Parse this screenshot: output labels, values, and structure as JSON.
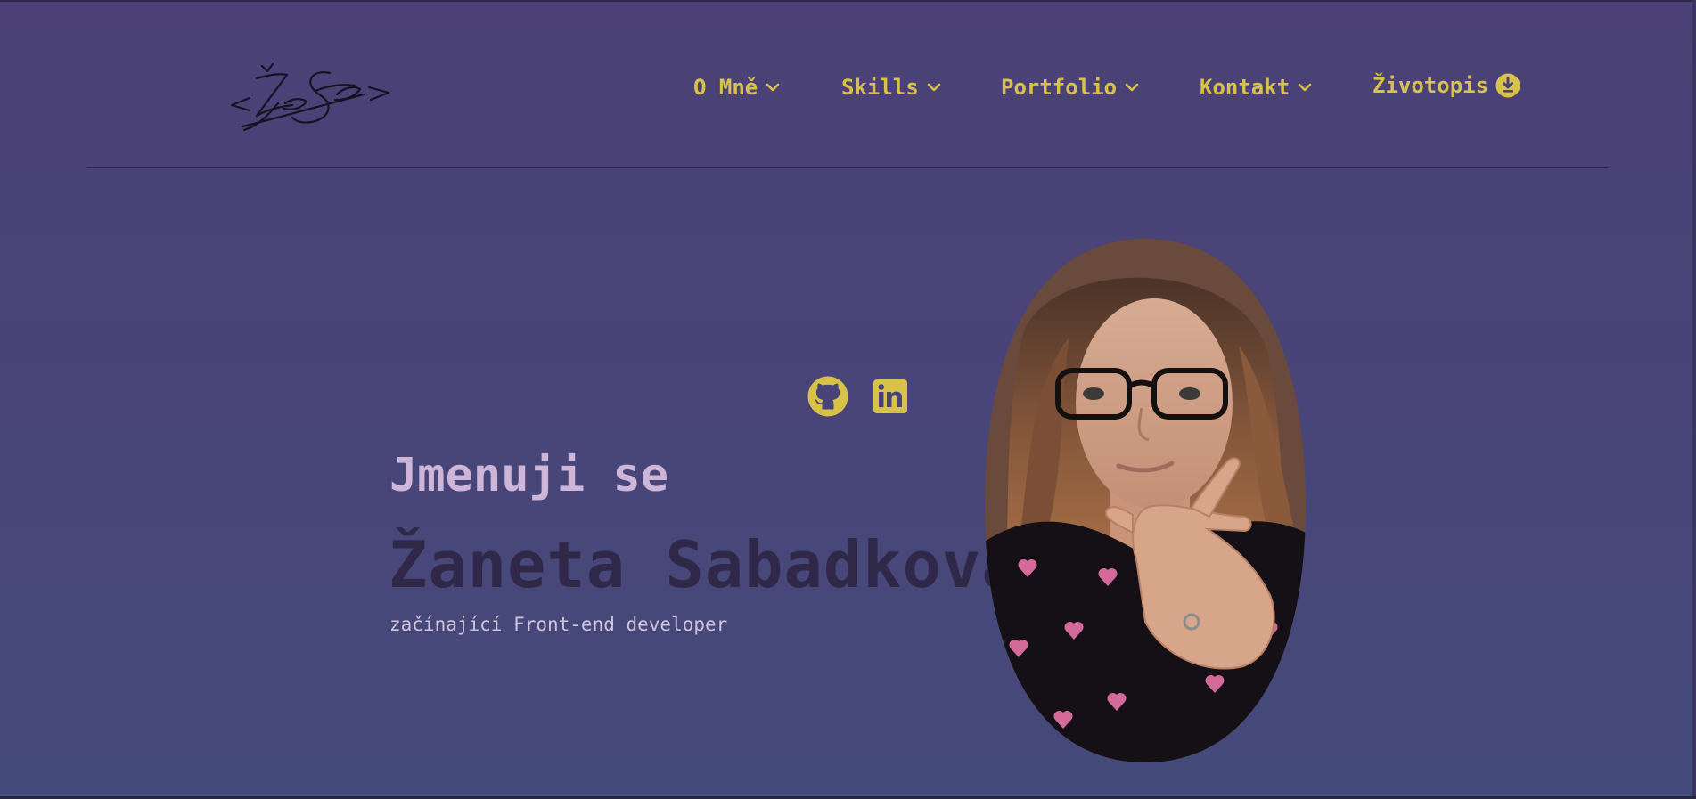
{
  "header": {
    "logo_icon": "signature-logo-icon",
    "nav": [
      {
        "label": "O Mně",
        "icon": "chevron-down-icon"
      },
      {
        "label": "Skills",
        "icon": "chevron-down-icon"
      },
      {
        "label": "Portfolio",
        "icon": "chevron-down-icon"
      },
      {
        "label": "Kontakt",
        "icon": "chevron-down-icon"
      },
      {
        "label": "Životopis",
        "icon": "download-icon"
      }
    ]
  },
  "hero": {
    "intro": "Jmenuji se",
    "name": "Žaneta Sabadková",
    "subtitle": "začínající Front-end developer",
    "socials": [
      {
        "icon": "github-icon"
      },
      {
        "icon": "linkedin-icon"
      }
    ],
    "portrait_icon": "portrait-photo"
  },
  "colors": {
    "background": "#4a4377",
    "accent": "#d8c24a",
    "intro_text": "#cdb6d8",
    "name_text": "#2f2848"
  }
}
